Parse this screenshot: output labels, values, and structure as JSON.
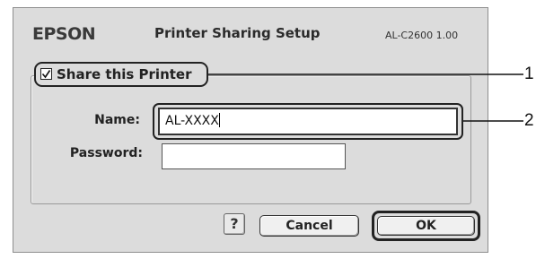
{
  "dialog": {
    "brand": "EPSON",
    "title": "Printer Sharing Setup",
    "version": "AL-C2600 1.00"
  },
  "share": {
    "checkbox_checked": true,
    "label": "Share this Printer"
  },
  "fields": {
    "name_label": "Name:",
    "name_value": "AL-XXXX",
    "password_label": "Password:",
    "password_value": ""
  },
  "buttons": {
    "help": "?",
    "cancel": "Cancel",
    "ok": "OK"
  },
  "callouts": [
    "1",
    "2"
  ]
}
